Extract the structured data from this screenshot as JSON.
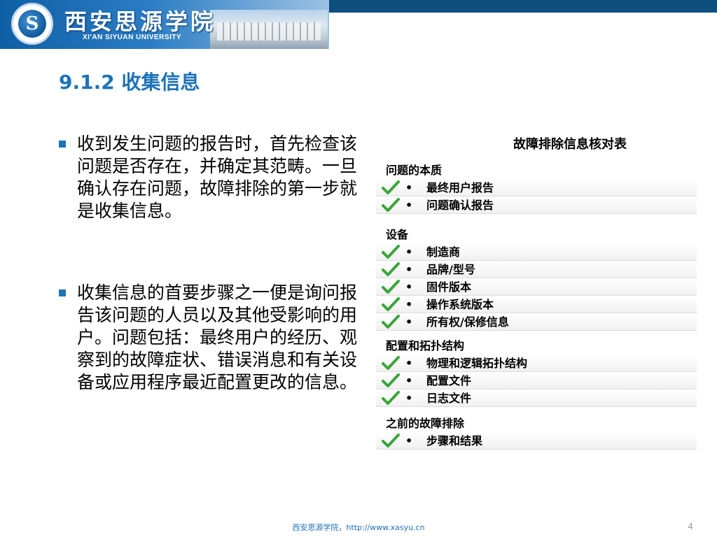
{
  "header": {
    "logo_glyph": "S",
    "university_cn": "西安思源学院",
    "university_en": "XI'AN SIYUAN UNIVERSITY",
    "accent_color": "#1e72b8",
    "bar_color": "#0f4f7e"
  },
  "slide": {
    "title": "9.1.2 收集信息",
    "bullets": [
      "收到发生问题的报告时，首先检查该问题是否存在，并确定其范畴。一旦确认存在问题，故障排除的第一步就是收集信息。",
      "收集信息的首要步骤之一便是询问报告该问题的人员以及其他受影响的用户。问题包括：最终用户的经历、观察到的故障症状、错误消息和有关设备或应用程序最近配置更改的信息。"
    ]
  },
  "checklist": {
    "title": "故障排除信息核对表",
    "bullet_glyph": "•",
    "check_icon": "check-icon",
    "sections": [
      {
        "heading": "问题的本质",
        "items": [
          "最终用户报告",
          "问题确认报告"
        ]
      },
      {
        "heading": "设备",
        "items": [
          "制造商",
          "品牌/型号",
          "固件版本",
          "操作系统版本",
          "所有权/保修信息"
        ]
      },
      {
        "heading": "配置和拓扑结构",
        "items": [
          "物理和逻辑拓扑结构",
          "配置文件",
          "日志文件"
        ]
      },
      {
        "heading": "之前的故障排除",
        "items": [
          "步骤和结果"
        ]
      }
    ]
  },
  "footer": {
    "text": "西安思源学院，http://www.xasyu.cn",
    "page_number": "4"
  }
}
